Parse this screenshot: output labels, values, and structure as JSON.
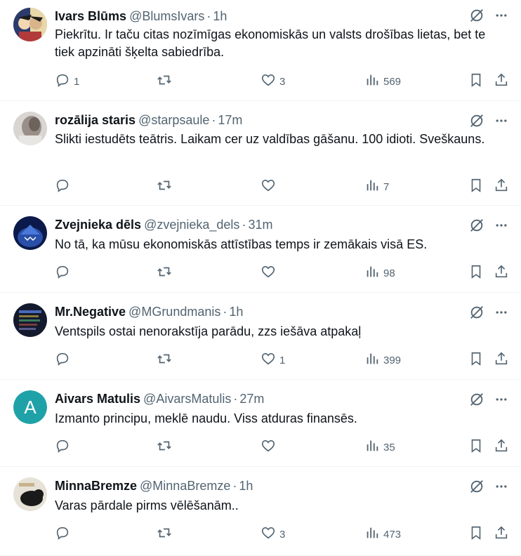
{
  "posts": [
    {
      "author": "Ivars Blūms",
      "handle": "@BlumsIvars",
      "separator": "·",
      "time": "1h",
      "text": "Piekrītu.  Ir taču citas nozīmīgas ekonomiskās un valsts drošības lietas,  bet te tiek apzināti šķelta sabiedrība.",
      "replies": "1",
      "reposts": "",
      "likes": "3",
      "views": "569",
      "avatar": "comic-art"
    },
    {
      "author": "rozālija staris",
      "handle": "@starpsaule",
      "separator": "·",
      "time": "17m",
      "text": "Slikti iestudēts teātris. Laikam cer uz valdības gāšanu. 100 idioti. Sveškauns.",
      "replies": "",
      "reposts": "",
      "likes": "",
      "views": "7",
      "avatar": "photo-gray"
    },
    {
      "author": "Zvejnieka dēls",
      "handle": "@zvejnieka_dels",
      "separator": "·",
      "time": "31m",
      "text": "No tā, ka mūsu ekonomiskās attīstības temps ir zemākais visā ES.",
      "replies": "",
      "reposts": "",
      "likes": "",
      "views": "98",
      "avatar": "shark-blue"
    },
    {
      "author": "Mr.Negative",
      "handle": "@MGrundmanis",
      "separator": "·",
      "time": "1h",
      "text": "Ventspils ostai nenorakstīja parādu, zzs iešāva atpakaļ",
      "replies": "",
      "reposts": "",
      "likes": "1",
      "views": "399",
      "avatar": "dark-list"
    },
    {
      "author": "Aivars Matulis",
      "handle": "@AivarsMatulis",
      "separator": "·",
      "time": "27m",
      "text": "Izmanto principu, meklē naudu. Viss atduras finansēs.",
      "replies": "",
      "reposts": "",
      "likes": "",
      "views": "35",
      "avatar": "letter",
      "avatar_letter": "A"
    },
    {
      "author": "MinnaBremze",
      "handle": "@MinnaBremze",
      "separator": "·",
      "time": "1h",
      "text": "Varas pārdale pirms vēlēšanām..",
      "replies": "",
      "reposts": "",
      "likes": "3",
      "views": "473",
      "avatar": "cat-photo"
    }
  ],
  "icons": {
    "grok": "grok-icon",
    "more": "more-icon",
    "reply": "reply-icon",
    "repost": "repost-icon",
    "like": "heart-icon",
    "views": "views-icon",
    "bookmark": "bookmark-icon",
    "share": "share-icon"
  },
  "colors": {
    "text": "#0f1419",
    "secondary": "#536471",
    "divider": "#eff3f4",
    "avatar_letter_bg": "#1ea2a8"
  }
}
